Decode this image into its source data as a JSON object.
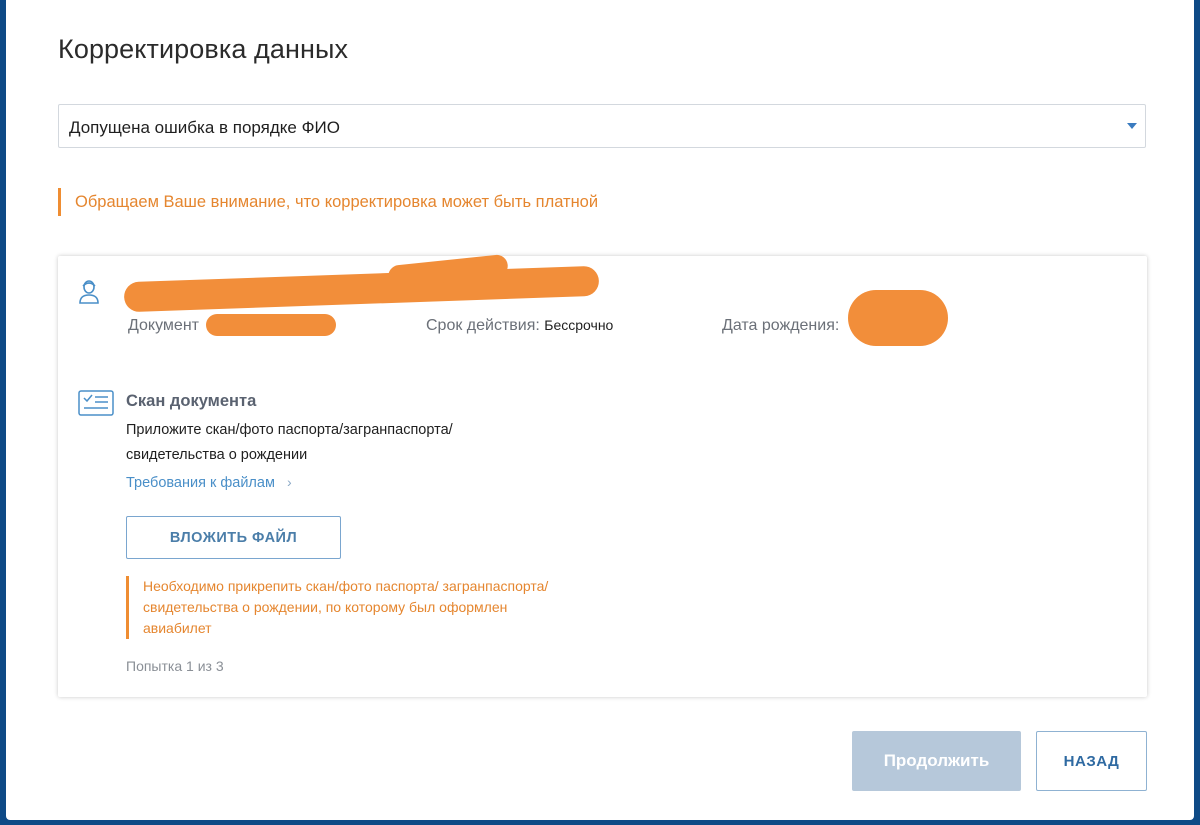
{
  "page": {
    "title": "Корректировка данных"
  },
  "reason_select": {
    "value": "Допущена ошибка в порядке ФИО"
  },
  "notice": {
    "text": "Обращаем Ваше внимание, что корректировка может быть платной"
  },
  "passenger": {
    "document_label": "Документ",
    "validity_label": "Срок действия:",
    "validity_value": "Бессрочно",
    "birthdate_label": "Дата рождения:"
  },
  "scan": {
    "title": "Скан документа",
    "description": "Приложите скан/фото паспорта/загранпаспорта/ свидетельства о рождении",
    "requirements_link": "Требования к файлам",
    "requirements_chevron": "›",
    "attach_button": "ВЛОЖИТЬ ФАЙЛ",
    "warning": "Необходимо прикрепить скан/фото паспорта/ загранпаспорта/свидетельства о рождении, по которому был оформлен авиабилет",
    "attempt": "Попытка 1 из 3"
  },
  "actions": {
    "continue_label": "Продолжить",
    "back_label": "НАЗАД"
  },
  "colors": {
    "accent_orange": "#ef8d32",
    "link_blue": "#4a8fc8",
    "disabled_button": "#b6c8da",
    "redaction": "#f28e3a"
  },
  "icons": {
    "person": "person-outline-icon",
    "document": "document-scan-icon",
    "dropdown": "caret-down-icon"
  }
}
